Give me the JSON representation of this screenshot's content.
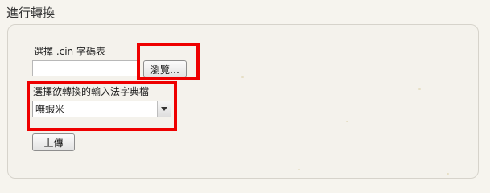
{
  "section": {
    "title": "進行轉換"
  },
  "file_upload": {
    "label": "選擇 .cin 字碼表",
    "path_value": "",
    "browse_label": "瀏覽…"
  },
  "dictionary": {
    "label": "選擇欲轉換的輸入法字典檔",
    "selected": "嘸蝦米"
  },
  "actions": {
    "upload_label": "上傳"
  },
  "colors": {
    "highlight": "#ee0000",
    "background": "#f6f4ee"
  }
}
